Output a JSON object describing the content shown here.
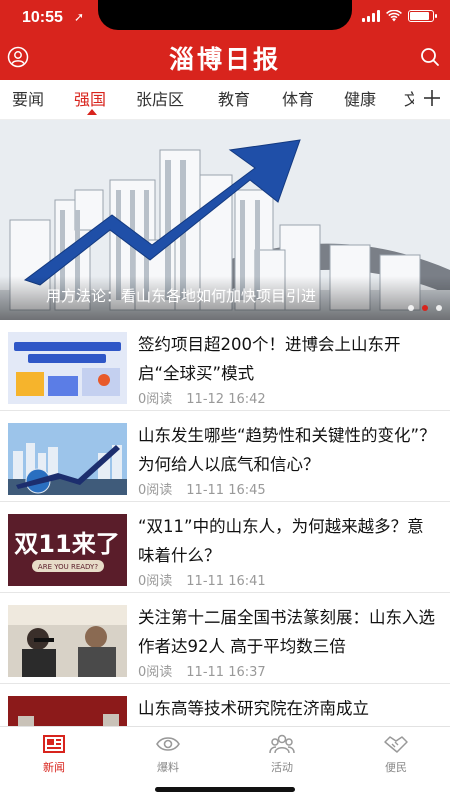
{
  "status_bar": {
    "time": "10:55"
  },
  "header": {
    "logo_text": "淄博日报"
  },
  "tabs": [
    {
      "label": "要闻"
    },
    {
      "label": "强国"
    },
    {
      "label": "张店区"
    },
    {
      "label": "教育"
    },
    {
      "label": "体育"
    },
    {
      "label": "健康"
    }
  ],
  "tabs_partial": "文",
  "active_tab": "强国",
  "banner": {
    "caption": "用方法论：看山东各地如何加快项目引进"
  },
  "news": [
    {
      "title": "签约项目超200个！进博会上山东开启“全球买”模式",
      "reads": "0阅读",
      "date": "11-12 16:42",
      "thumb_text_1": "进博会上山东开启“全球买”模式",
      "thumb_text_2": "签约项目超200个"
    },
    {
      "title": "山东发生哪些“趋势性和关键性的变化”？为何给人以底气和信心？",
      "reads": "0阅读",
      "date": "11-11 16:45"
    },
    {
      "title": "“双11”中的山东人，为何越来越多？意味着什么？",
      "reads": "0阅读",
      "date": "11-11 16:41",
      "thumb_text_1": "双11来了",
      "thumb_text_2": "ARE YOU READY?"
    },
    {
      "title": "关注第十二届全国书法篆刻展：山东入选作者达92人 高于平均数三倍",
      "reads": "0阅读",
      "date": "11-11 16:37"
    },
    {
      "title": "山东高等技术研究院在济南成立"
    }
  ],
  "bottom_nav": [
    {
      "label": "新闻"
    },
    {
      "label": "爆料"
    },
    {
      "label": "活动"
    },
    {
      "label": "便民"
    }
  ],
  "colors": {
    "brand_red": "#d8241d",
    "meta_gray": "#999999"
  }
}
